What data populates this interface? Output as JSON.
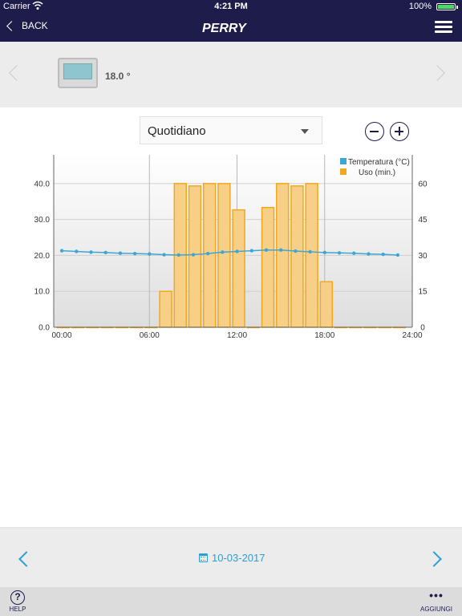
{
  "status_bar": {
    "carrier": "Carrier",
    "time": "4:21 PM",
    "battery": "100%"
  },
  "nav": {
    "back_label": "BACK",
    "logo_text": "PERRY"
  },
  "device": {
    "temperature": "18.0 °"
  },
  "controls": {
    "period": "Quotidiano"
  },
  "date_bar": {
    "date": "10-03-2017"
  },
  "bottom_bar": {
    "help_label": "HELP",
    "add_label": "AGGIUNGI"
  },
  "colors": {
    "nav_bg": "#1e1c4a",
    "accent": "#2a9fd6",
    "bar_fill": "#f7cf87",
    "bar_stroke": "#f0a820",
    "temp_line": "#3ea6d2"
  },
  "chart_data": {
    "type": "bar+line",
    "x_ticks": [
      "00:00",
      "06:00",
      "12:00",
      "18:00",
      "24:00"
    ],
    "y_left_ticks": [
      "0.0",
      "10.0",
      "20.0",
      "30.0",
      "40.0"
    ],
    "y_right_ticks": [
      "0",
      "15",
      "30",
      "45",
      "60"
    ],
    "y_left_range": [
      0,
      48
    ],
    "y_right_range": [
      0,
      72
    ],
    "grid": true,
    "legend_position": "top-right",
    "series": [
      {
        "name": "Temperatura (°C)",
        "type": "line",
        "axis": "left",
        "x": [
          0,
          1,
          2,
          3,
          4,
          5,
          6,
          7,
          8,
          9,
          10,
          11,
          12,
          13,
          14,
          15,
          16,
          17,
          18,
          19,
          20,
          21,
          22,
          23
        ],
        "values": [
          21.3,
          21.1,
          20.9,
          20.8,
          20.6,
          20.5,
          20.4,
          20.2,
          20.1,
          20.2,
          20.5,
          20.9,
          21.1,
          21.3,
          21.5,
          21.5,
          21.2,
          21.0,
          20.8,
          20.7,
          20.6,
          20.4,
          20.3,
          20.1
        ]
      },
      {
        "name": "Uso (min.)",
        "type": "bar",
        "axis": "right",
        "x": [
          0,
          1,
          2,
          3,
          4,
          5,
          6,
          7,
          8,
          9,
          10,
          11,
          12,
          13,
          14,
          15,
          16,
          17,
          18,
          19,
          20,
          21,
          22,
          23
        ],
        "values": [
          0,
          0,
          0,
          0,
          0,
          0,
          0,
          15,
          60,
          59,
          60,
          60,
          49,
          0,
          50,
          60,
          59,
          60,
          19,
          0,
          0,
          0,
          0,
          0
        ]
      }
    ]
  }
}
